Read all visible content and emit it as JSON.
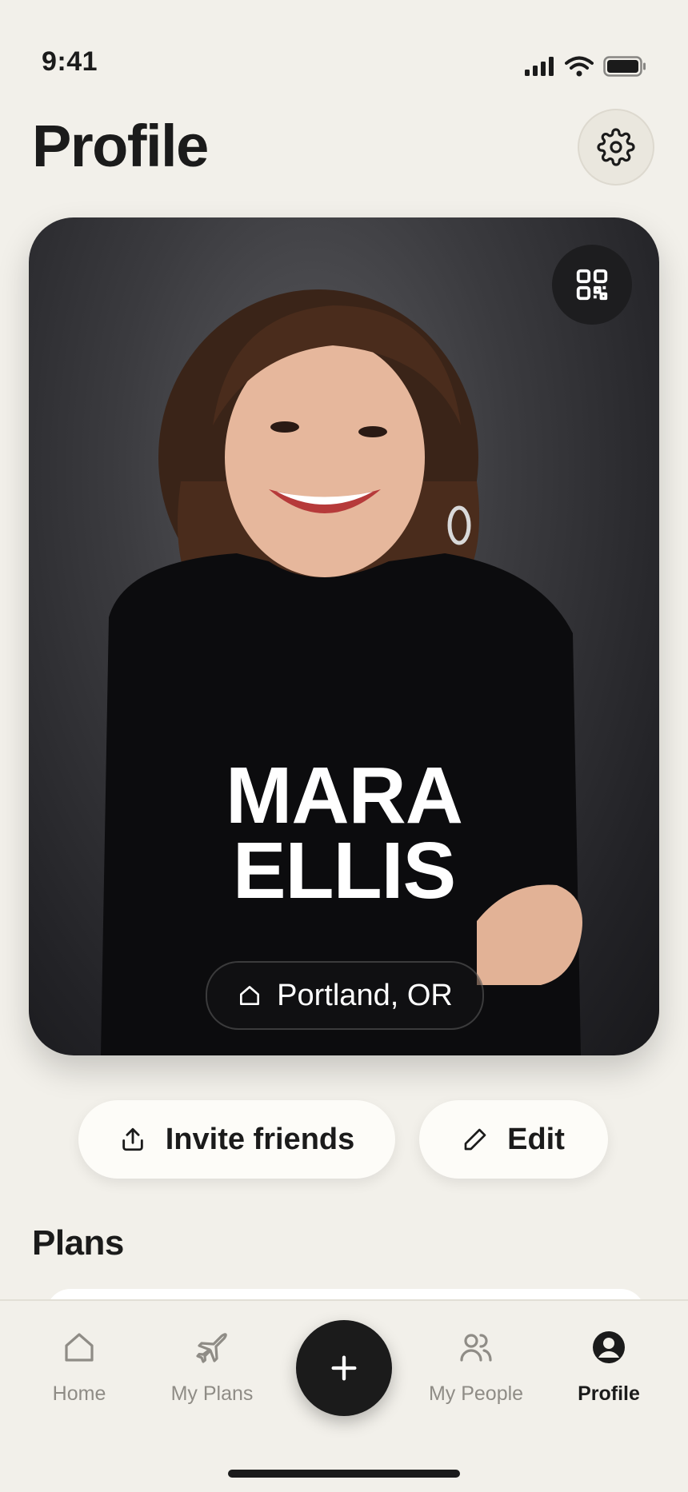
{
  "status_bar": {
    "time": "9:41",
    "icons": [
      "signal-icon",
      "wifi-icon",
      "battery-icon"
    ]
  },
  "header": {
    "title": "Profile",
    "settings_icon": "gear-icon"
  },
  "profile_card": {
    "first_name": "MARA",
    "last_name": "ELLIS",
    "location": "Portland, OR",
    "location_icon": "home-icon",
    "qr_icon": "qr-code-icon"
  },
  "actions": {
    "invite_label": "Invite friends",
    "invite_icon": "share-icon",
    "edit_label": "Edit",
    "edit_icon": "pencil-icon"
  },
  "plans": {
    "heading": "Plans"
  },
  "tab_bar": {
    "items": [
      {
        "label": "Home",
        "icon": "home-icon",
        "active": false
      },
      {
        "label": "My Plans",
        "icon": "airplane-icon",
        "active": false
      },
      {
        "label": "My People",
        "icon": "people-icon",
        "active": false
      },
      {
        "label": "Profile",
        "icon": "profile-icon",
        "active": true
      }
    ],
    "fab_icon": "plus-icon"
  },
  "colors": {
    "background": "#F2F0EA",
    "ink": "#1B1B1B",
    "muted": "#8F8C86",
    "card": "#FDFCF8"
  }
}
